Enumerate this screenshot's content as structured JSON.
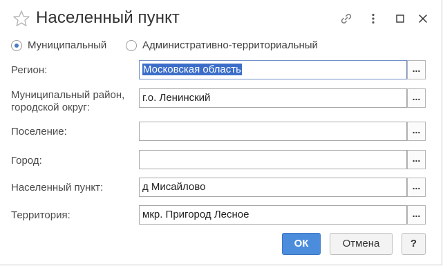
{
  "window": {
    "title": "Населенный пункт"
  },
  "address_type": {
    "options": [
      {
        "label": "Муниципальный",
        "selected": true
      },
      {
        "label": "Административно-территориальный",
        "selected": false
      }
    ]
  },
  "fields": {
    "region": {
      "label": "Регион:",
      "value": "Московская область"
    },
    "municipal_district": {
      "label_line1": "Муниципальный район,",
      "label_line2": "городской округ:",
      "value": "г.о. Ленинский"
    },
    "settlement": {
      "label": "Поселение:",
      "value": ""
    },
    "city": {
      "label": "Город:",
      "value": ""
    },
    "locality": {
      "label": "Населенный пункт:",
      "value": "д Мисайлово"
    },
    "territory": {
      "label": "Территория:",
      "value": "мкр. Пригород Лесное"
    }
  },
  "pick_button_label": "...",
  "buttons": {
    "ok": "ОК",
    "cancel": "Отмена",
    "help": "?"
  },
  "colors": {
    "accent": "#4b8ddc",
    "selection": "#3c6ec9",
    "radio_dot": "#4a7cc4"
  },
  "icons": {
    "favorite": "star-outline-icon",
    "link": "link-icon",
    "more": "more-vertical-icon",
    "maximize": "maximize-icon",
    "close": "close-icon"
  }
}
